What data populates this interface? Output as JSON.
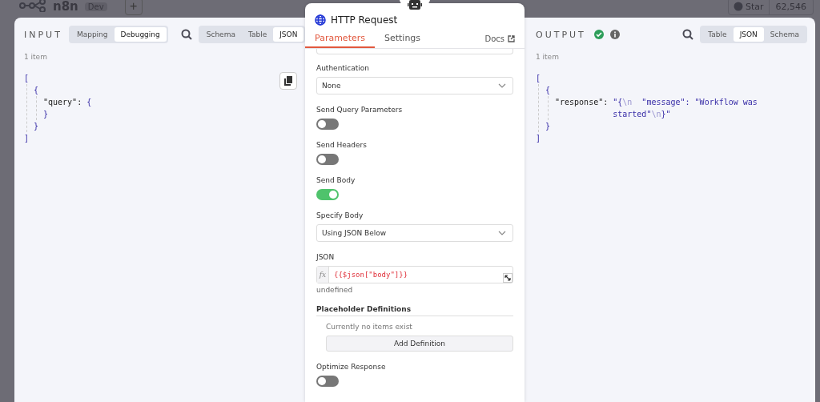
{
  "background": {
    "logo": "n8n",
    "badge": "Dev",
    "add_button": "+",
    "github": {
      "label": "Star",
      "count": "62,546"
    }
  },
  "input_panel": {
    "title": "INPUT",
    "modes": [
      {
        "label": "Mapping",
        "selected": false
      },
      {
        "label": "Debugging",
        "selected": true
      }
    ],
    "views": [
      {
        "label": "Schema",
        "selected": false
      },
      {
        "label": "Table",
        "selected": false
      },
      {
        "label": "JSON",
        "selected": true
      }
    ],
    "count": "1 item",
    "json": {
      "open": "[",
      "close": "]",
      "children": [
        {
          "open": "{",
          "close": "}",
          "children": [
            {
              "key": "\"query\":",
              "open": "{",
              "close": "}"
            }
          ]
        }
      ]
    }
  },
  "node_panel": {
    "title": "HTTP Request",
    "tabs": [
      {
        "label": "Parameters",
        "selected": true
      },
      {
        "label": "Settings",
        "selected": false
      }
    ],
    "docs": "Docs",
    "params": [
      {
        "kind": "select",
        "label": "Authentication",
        "value": "None"
      },
      {
        "kind": "toggle",
        "label": "Send Query Parameters",
        "on": false
      },
      {
        "kind": "toggle",
        "label": "Send Headers",
        "on": false
      },
      {
        "kind": "toggle",
        "label": "Send Body",
        "on": true
      },
      {
        "kind": "select",
        "label": "Specify Body",
        "value": "Using JSON Below"
      },
      {
        "kind": "expression",
        "label": "JSON",
        "prefix": "fx",
        "value": "{{$json[\"body\"]}}",
        "hint": "undefined"
      },
      {
        "kind": "collection",
        "label": "Placeholder Definitions",
        "empty_text": "Currently no items exist",
        "button": "Add Definition"
      },
      {
        "kind": "toggle",
        "label": "Optimize Response",
        "on": false
      }
    ]
  },
  "output_panel": {
    "title": "OUTPUT",
    "views": [
      {
        "label": "Table",
        "selected": false
      },
      {
        "label": "JSON",
        "selected": true
      },
      {
        "label": "Schema",
        "selected": false
      }
    ],
    "count": "1 item",
    "json": {
      "open": "[",
      "close": "]",
      "children": [
        {
          "open": "{",
          "close": "}",
          "children": [
            {
              "key": "\"response\":",
              "value_parts": [
                {
                  "kind": "str",
                  "text": "\"{"
                },
                {
                  "kind": "escape",
                  "text": "\\n"
                },
                {
                  "kind": "str",
                  "text": "  \"message\": \"Workflow was started\""
                },
                {
                  "kind": "escape",
                  "text": "\\n"
                },
                {
                  "kind": "str",
                  "text": "}\""
                }
              ]
            }
          ]
        }
      ]
    }
  }
}
